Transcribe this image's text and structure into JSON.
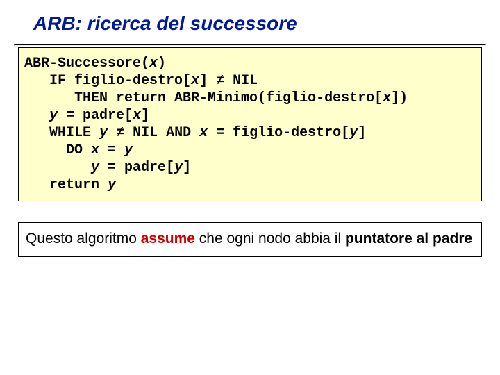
{
  "title": "ARB: ricerca del successore",
  "code": {
    "fn_name": "ABR-Successore(",
    "fn_arg": "x",
    "fn_close": ")",
    "l2a": "   IF figlio-destro[",
    "l2b": "x",
    "l2c": "] ",
    "l2d": "≠",
    "l2e": " NIL",
    "l3a": "      THEN return ABR-Minimo(figlio-destro[",
    "l3b": "x",
    "l3c": "])",
    "l4a": "   ",
    "l4b": "y",
    "l4c": " = padre[",
    "l4d": "x",
    "l4e": "]",
    "l5a": "   WHILE ",
    "l5b": "y",
    "l5c": " ",
    "l5d": "≠",
    "l5e": " NIL AND ",
    "l5f": "x",
    "l5g": " = figlio-destro[",
    "l5h": "y",
    "l5i": "]",
    "l6a": "     DO ",
    "l6b": "x",
    "l6c": " = ",
    "l6d": "y",
    "l7a": "        ",
    "l7b": "y",
    "l7c": " = padre[",
    "l7d": "y",
    "l7e": "]",
    "l8a": "   return ",
    "l8b": "y"
  },
  "note": {
    "part1": "Questo algoritmo ",
    "assume": "assume",
    "part2": " che ogni nodo abbia il ",
    "part3": "puntatore al padre"
  }
}
